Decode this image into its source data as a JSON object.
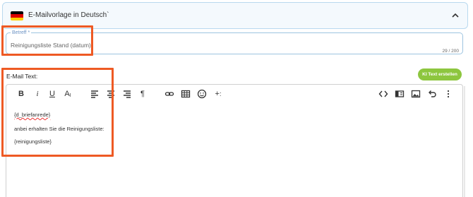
{
  "header": {
    "title": "E-Mailvorlage in Deutsch`",
    "flag_colors": [
      "#000000",
      "#dd0000",
      "#ffce00"
    ],
    "chevron_icon": "chevron-up-icon"
  },
  "subject": {
    "label": "Betreff *",
    "value": "Reinigungsliste Stand (datum)",
    "char_count": "29 / 200"
  },
  "email": {
    "label": "E-Mail Text:",
    "ki_button_label": "KI Text erstellen",
    "ki_button_color": "#8dc63f"
  },
  "toolbar": {
    "bold": "B",
    "italic": "i",
    "underline": "U",
    "font_size": "A",
    "paragraph": "¶",
    "insert_plus": "+"
  },
  "editor": {
    "lines": [
      "{d_briefanrede}",
      "anbei erhalten Sie die Reinigungsliste:",
      "{reinigungsliste}"
    ]
  },
  "annotation_color": "#ee5a24"
}
